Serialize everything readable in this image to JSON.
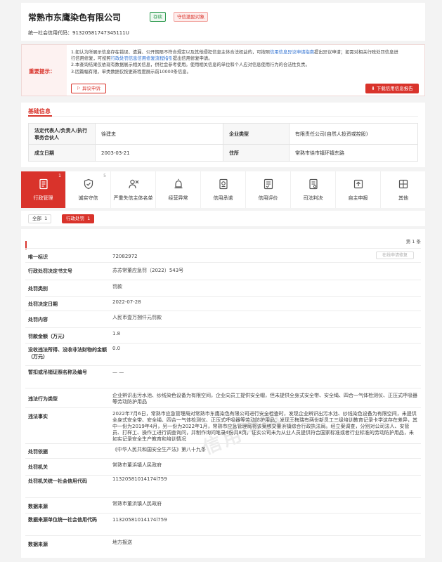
{
  "header": {
    "company_name": "常熟市东鹰染色有限公司",
    "tag_status": "存续",
    "tag_dishonest": "守信激励对象",
    "uscc_label": "统一社会信用代码：",
    "uscc_value": "91320581747345111U"
  },
  "notice": {
    "title": "重要提示：",
    "line1_a": "1.如认为所展示信息存在错误、遗漏、公开期限不符合规定以及其他侵犯信息主体合法权益的，可按照",
    "line1_link": "信用信息异议申请指南",
    "line1_b": "提出异议申请；如需对相关行政处罚信息进",
    "line2_a": "行信用修复，可按照",
    "line2_link": "行政处罚信息信用修复流程指引",
    "line2_b": "提出信用修复申请。",
    "line3": "2.本查询结果仅依现有数据展示相关信息，供社会参考使用。使用相关信息的单位和个人应对信息使用行为的合法性负责。",
    "line4": "3.因篇幅有限，单类数据仅按更新程度展示前10000条信息。",
    "objection_button": "异议申诉",
    "download_button": "下载信用信息报告"
  },
  "basic": {
    "title": "基础信息",
    "legal_rep_label": "法定代表人/负责人/执行事务合伙人",
    "legal_rep_value": "徐建忠",
    "type_label": "企业类型",
    "type_value": "有限责任公司(自然人投资或控股)",
    "founded_label": "成立日期",
    "founded_value": "2003-03-21",
    "address_label": "住所",
    "address_value": "常熟市徐市镇环镇东路"
  },
  "tabs": [
    {
      "label": "行政管理",
      "count": "1",
      "icon": "document-icon"
    },
    {
      "label": "诚实守信",
      "count": "5",
      "icon": "shield-check-icon"
    },
    {
      "label": "严重失信主体名单",
      "count": "",
      "icon": "blacklist-icon"
    },
    {
      "label": "经营异常",
      "count": "",
      "icon": "alarm-icon"
    },
    {
      "label": "信用承诺",
      "count": "",
      "icon": "pledge-icon"
    },
    {
      "label": "信用评价",
      "count": "",
      "icon": "evaluation-icon"
    },
    {
      "label": "司法判决",
      "count": "",
      "icon": "judgment-icon"
    },
    {
      "label": "自主申报",
      "count": "",
      "icon": "upload-icon"
    },
    {
      "label": "其他",
      "count": "",
      "icon": "other-icon"
    }
  ],
  "filters": {
    "all_label": "全部",
    "all_count": "1",
    "penalty_label": "行政处罚",
    "penalty_count": "1"
  },
  "detail": {
    "page_no": "第 1 条",
    "repair_button": "在线申请修复",
    "watermark": "信用中国",
    "rows": [
      {
        "label": "唯一标识",
        "value": "72082972"
      },
      {
        "label": "行政处罚决定书文号",
        "value": "苏苏常董应急罚（2022）543号"
      },
      {
        "label": "处罚类别",
        "value": "罚款"
      },
      {
        "label": "处罚决定日期",
        "value": "2022-07-28"
      },
      {
        "label": "处罚内容",
        "value": "人民币壹万捌仟元罚款"
      },
      {
        "label": "罚款金额（万元）",
        "value": "1.8"
      },
      {
        "label": "没收违法所得、没收非法财物的金额（万元）",
        "value": "0.0"
      },
      {
        "label": "暂扣或吊销证照名称及编号",
        "value": "— —"
      },
      {
        "label": "违法行为类型",
        "value": "企业辨识出污水池、纱线染色设备为有限空间，企业向员工提供安全帽，但未提供全身式安全带、安全绳、四合一气体检测仪、正压式呼吸器等劳动防护用品"
      },
      {
        "label": "违法事实",
        "value": "2022年7月6日，常熟市应急管理局对常熟市东鹰染色有限公司进行安全检查时，发现企业辨识出污水池、纱线染色设备为有限空间，未提供全身式安全带、安全绳、四合一气体检测仪、正压式呼吸器等劳动防护用品；发现王梅瑞有两份新员工三级培训教育记录卡学这存在差异，其中一份为2019年4月，另一份为2022年1月，常熟市应急管理局将该案移交董浜镇综合行政执法局。经立案调查，分别对公司法人、安管员、打样工、操作工进行调查询问，并制作询问笔录4份共8页，证实公司未为从业人员提供符合国家标准或者行业标准的劳动防护用品，未如实记录安全生产教育和培训情况"
      },
      {
        "label": "处罚依据",
        "value": "《中华人民共和国安全生产法》第八十九条"
      },
      {
        "label": "处罚机关",
        "value": "常熟市董浜镇人民政府"
      },
      {
        "label": "处罚机关统一社会信用代码",
        "value": "11320581014174l759"
      },
      {
        "label": "数据来源",
        "value": "常熟市董浜镇人民政府"
      },
      {
        "label": "数据来源单位统一社会信用代码",
        "value": "11320581014174l759"
      },
      {
        "label": "数据来源",
        "value": "地方报送"
      }
    ]
  }
}
